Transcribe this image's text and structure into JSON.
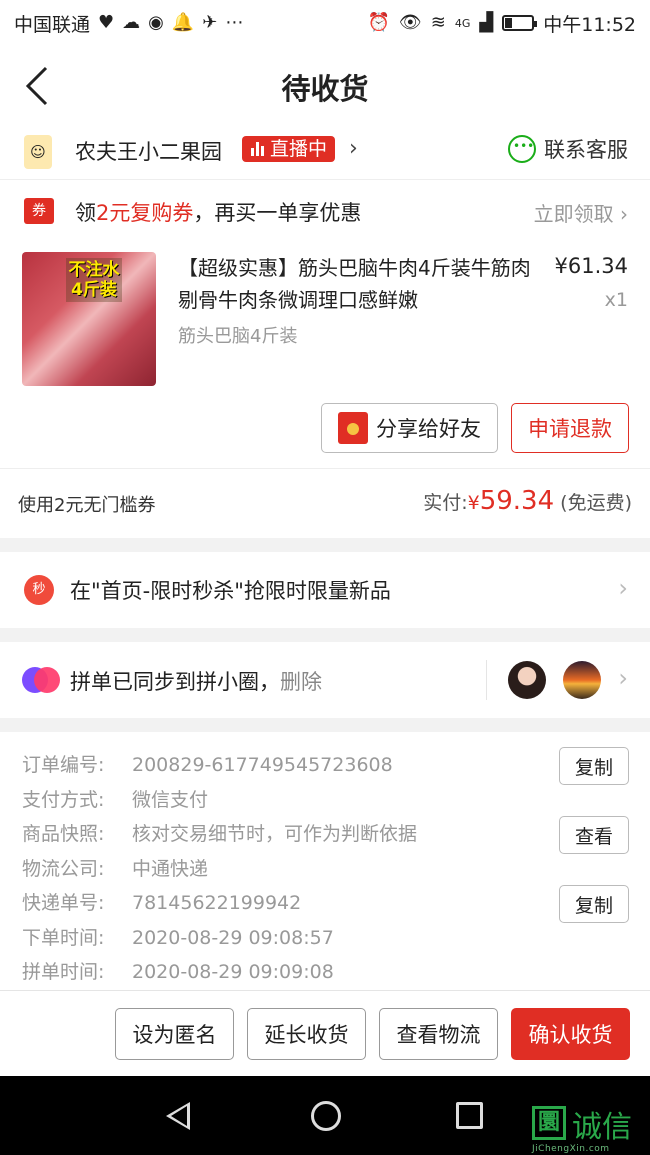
{
  "statusbar": {
    "carrier": "中国联通",
    "network": "4G",
    "time": "中午11:52",
    "battery_level": 0.25
  },
  "navbar": {
    "title": "待收货"
  },
  "shop": {
    "name": "农夫王小二果园",
    "live_label": "直播中",
    "chevron": "›",
    "customer_service": "联系客服"
  },
  "coupon": {
    "icon_text": "券",
    "text_prefix": "领",
    "text_highlight": "2元复购券",
    "text_suffix": "，再买一单享优惠",
    "action": "立即领取 ›"
  },
  "product": {
    "image_tag": "不注水 4斤装",
    "name": "【超级实惠】筋头巴脑牛肉4斤装牛筋肉剔骨牛肉条微调理口感鲜嫩",
    "price": "¥61.34",
    "quantity": "x1",
    "spec": "筋头巴脑4斤装",
    "share_button": "分享给好友",
    "refund_button": "申请退款"
  },
  "payment": {
    "coupon_used": "使用2元无门槛券",
    "paid_label": "实付:",
    "currency": "¥",
    "amount": "59.34",
    "shipping_note": "(免运费)"
  },
  "flash": {
    "icon_text": "秒",
    "text": "在\"首页-限时秒杀\"抢限时限量新品",
    "chevron": "›"
  },
  "group": {
    "text": "拼单已同步到拼小圈，",
    "delete": "删除",
    "chevron": "›"
  },
  "order_info": {
    "items": [
      {
        "label": "订单编号:",
        "value": "200829-617749545723608",
        "button": "复制"
      },
      {
        "label": "支付方式:",
        "value": "微信支付",
        "button": ""
      },
      {
        "label": "商品快照:",
        "value": "核对交易细节时，可作为判断依据",
        "button": "查看"
      },
      {
        "label": "物流公司:",
        "value": "中通快递",
        "button": ""
      },
      {
        "label": "快递单号:",
        "value": "78145622199942",
        "button": "复制"
      },
      {
        "label": "下单时间:",
        "value": "2020-08-29 09:08:57",
        "button": ""
      },
      {
        "label": "拼单时间:",
        "value": "2020-08-29 09:09:08",
        "button": ""
      }
    ]
  },
  "bottom_actions": {
    "anonymous": "设为匿名",
    "extend": "延长收货",
    "logistics": "查看物流",
    "confirm": "确认收货"
  },
  "watermark": {
    "logo": "圜",
    "text": "诚信",
    "sub": "JiChengXin.com"
  },
  "colors": {
    "accent_red": "#e02e24",
    "wechat_green": "#1aad19",
    "muted_gray": "#999999"
  }
}
